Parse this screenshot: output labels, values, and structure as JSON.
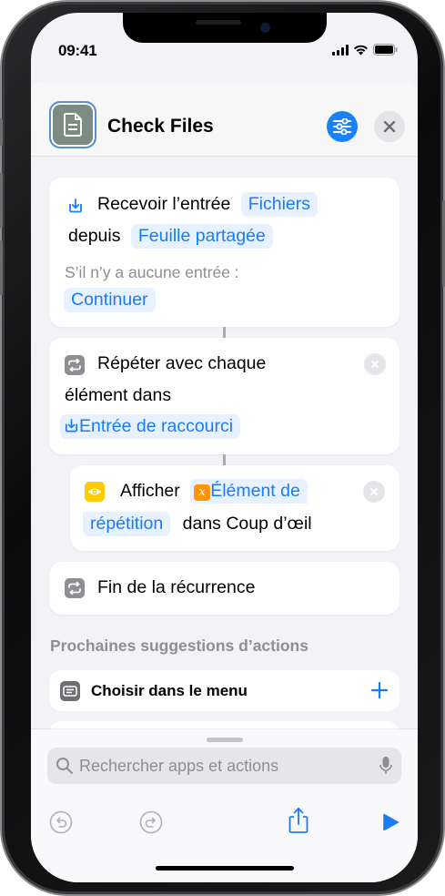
{
  "status": {
    "time": "09:41"
  },
  "header": {
    "title": "Check Files"
  },
  "actions": {
    "receive": {
      "label": "Recevoir l’entrée",
      "type_token": "Fichiers",
      "from_label": "depuis",
      "source_token": "Feuille partagée",
      "no_input_label": "S’il n’y a aucune entrée :",
      "no_input_token": "Continuer"
    },
    "repeat": {
      "label_line1": "Répéter avec chaque",
      "label_line2": "élément dans",
      "input_token": "Entrée de raccourci"
    },
    "show": {
      "label": "Afficher",
      "token_line1": "Élément de",
      "token_line2": "répétition",
      "suffix": "dans Coup d’œil"
    },
    "end_repeat": {
      "label": "Fin de la récurrence"
    }
  },
  "suggestions": {
    "title": "Prochaines suggestions d’actions",
    "items": [
      {
        "label": "Choisir dans le menu"
      }
    ]
  },
  "search": {
    "placeholder": "Rechercher apps et actions"
  },
  "colors": {
    "accent": "#1a7cf5",
    "token_bg": "#e8f1ff",
    "show_icon": "#ffcc00",
    "variable_icon": "#ff9500"
  }
}
